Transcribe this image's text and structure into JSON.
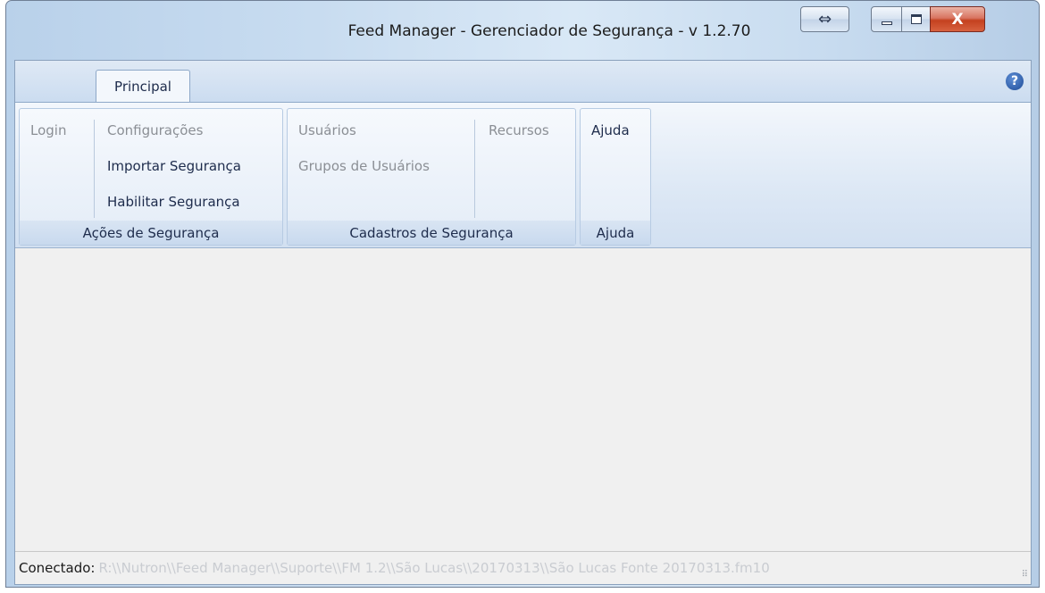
{
  "window": {
    "title": "Feed Manager - Gerenciador de Segurança - v 1.2.70",
    "buttons": {
      "expand": "⇔",
      "close": "X"
    }
  },
  "ribbon": {
    "tabs": [
      {
        "label": "Principal",
        "selected": true
      }
    ],
    "help_icon": "?",
    "groups": {
      "acoes": {
        "caption": "Ações de Segurança",
        "login": "Login",
        "configuracoes": "Configurações",
        "importar": "Importar Segurança",
        "habilitar": "Habilitar Segurança"
      },
      "cadastros": {
        "caption": "Cadastros de Segurança",
        "usuarios": "Usuários",
        "grupos": "Grupos de Usuários",
        "recursos": "Recursos"
      },
      "ajuda": {
        "caption": "Ajuda",
        "ajuda": "Ajuda"
      }
    }
  },
  "statusbar": {
    "label": "Conectado:",
    "path": "R:\\\\Nutron\\\\Feed Manager\\\\Suporte\\\\FM 1.2\\\\São Lucas\\\\20170313\\\\São Lucas Fonte 20170313.fm10"
  },
  "colors": {
    "accent": "#1e2c4c",
    "disabled": "#8b8f95",
    "close_button": "#c4411f"
  }
}
